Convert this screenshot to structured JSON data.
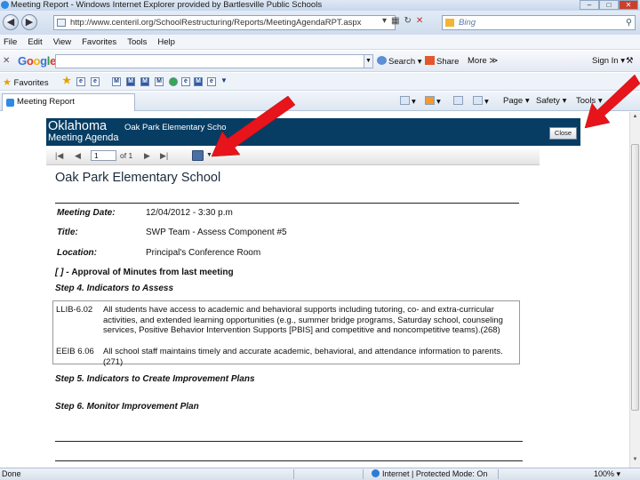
{
  "window": {
    "title": "Meeting Report - Windows Internet Explorer provided by Bartlesville Public Schools",
    "controls": [
      "–",
      "□",
      "✕"
    ]
  },
  "browser": {
    "address": "http://www.centeril.org/SchoolRestructuring/Reports/MeetingAgendaRPT.aspx",
    "search_placeholder": "Bing",
    "menu": [
      "File",
      "Edit",
      "View",
      "Favorites",
      "Tools",
      "Help"
    ],
    "google": {
      "logo": "Google",
      "search_label": "Search ▾",
      "share_label": "Share",
      "more_label": "More ≫",
      "signin_label": "Sign In ▾"
    },
    "favorites_label": "Favorites",
    "tab_title": "Meeting Report",
    "commands": {
      "page": "Page ▾",
      "safety": "Safety ▾",
      "tools": "Tools ▾"
    }
  },
  "report": {
    "state": "Oklahoma",
    "header_school": "Oak Park Elementary Scho",
    "subtitle": "Meeting Agenda",
    "close_label": "Close",
    "toolbar": {
      "page_value": "1",
      "of_label": "of 1"
    },
    "school_title": "Oak Park Elementary School",
    "fields": [
      {
        "label": "Meeting Date:",
        "value": "12/04/2012  -  3:30 p.m"
      },
      {
        "label": "Title:",
        "value": "SWP Team - Assess Component #5"
      },
      {
        "label": "Location:",
        "value": "Principal's Conference Room"
      }
    ],
    "approval_prefix": "[ ] -",
    "approval_text": "Approval of Minutes from last meeting",
    "step4": "Step 4. Indicators to Assess",
    "indicators": [
      {
        "code": "LLIB-6.02",
        "text": "All students have access to academic and behavioral supports including tutoring, co- and extra-curricular activities, and extended learning opportunities (e.g., summer bridge programs, Saturday school, counseling services, Positive Behavior Intervention Supports [PBIS] and competitive and noncompetitive teams).(268)"
      },
      {
        "code": "EEIB 6.06",
        "text": "All school staff maintains timely and accurate academic, behavioral, and attendance information to parents.(271)"
      }
    ],
    "step5": "Step 5. Indicators to Create Improvement Plans",
    "step6": "Step 6. Monitor Improvement Plan"
  },
  "status": {
    "left": "Done",
    "zone": "Internet | Protected Mode: On",
    "zoom": "100% ▾"
  },
  "colors": {
    "report_header": "#073d63",
    "arrow": "#e8141b"
  }
}
